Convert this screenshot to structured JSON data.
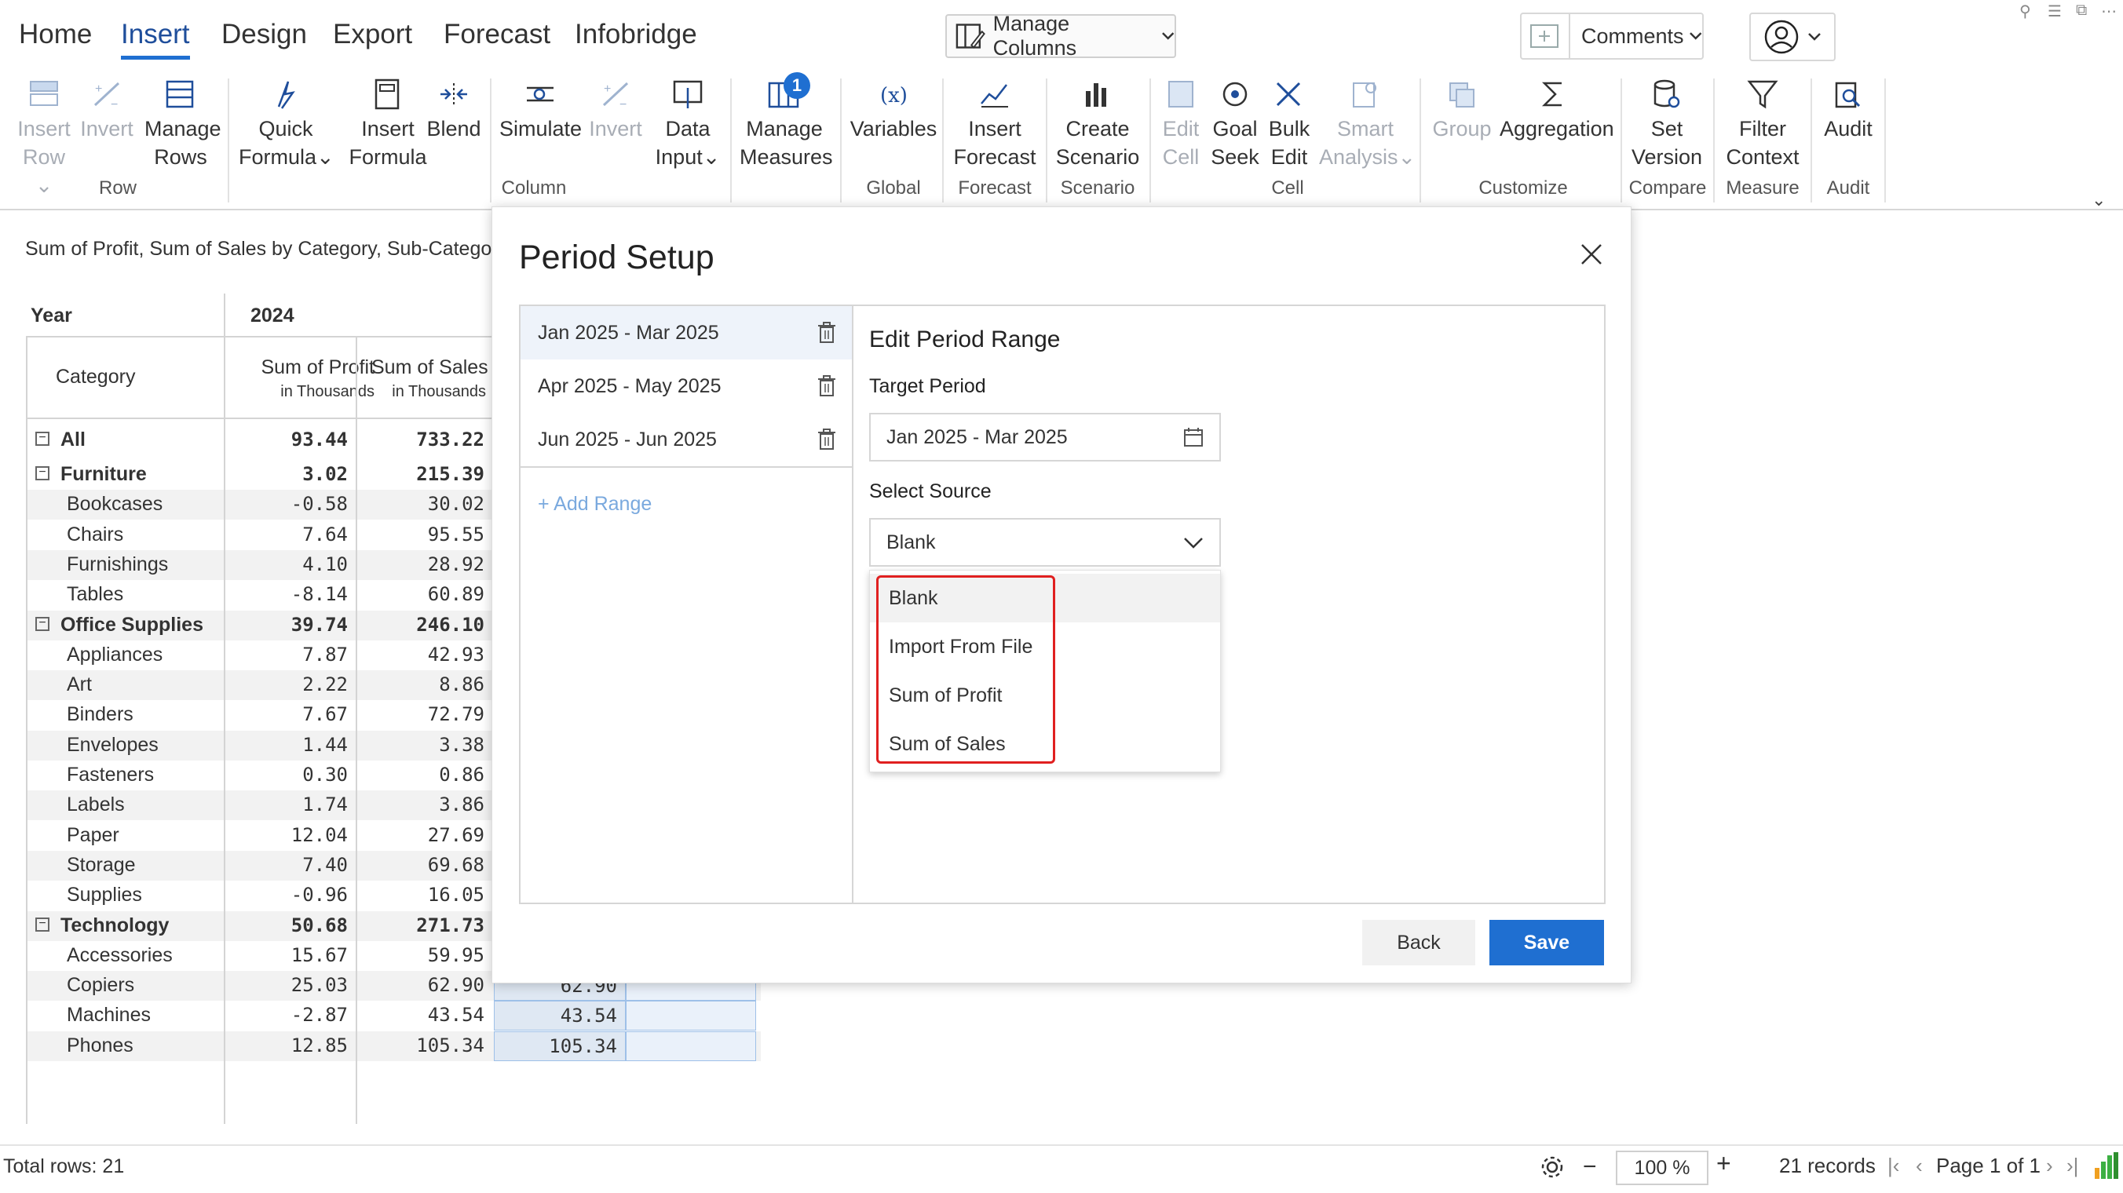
{
  "menu": {
    "tabs": [
      "Home",
      "Insert",
      "Design",
      "Export",
      "Forecast",
      "Infobridge"
    ],
    "active_tab": "Insert",
    "manage_columns": "Manage Columns",
    "comments": "Comments"
  },
  "ribbon": {
    "insert_row": [
      "Insert",
      "Row"
    ],
    "invert_row": "Invert",
    "manage_rows": [
      "Manage",
      "Rows"
    ],
    "group_row": "Row",
    "quick_formula": [
      "Quick",
      "Formula"
    ],
    "insert_formula": [
      "Insert",
      "Formula"
    ],
    "blend": "Blend",
    "simulate": "Simulate",
    "invert_col": "Invert",
    "data_input": [
      "Data",
      "Input"
    ],
    "group_column": "Column",
    "manage_measures": [
      "Manage",
      "Measures"
    ],
    "measures_badge": "1",
    "variables": "Variables",
    "group_global": "Global",
    "insert_forecast": [
      "Insert",
      "Forecast"
    ],
    "group_forecast": "Forecast",
    "create_scenario": [
      "Create",
      "Scenario"
    ],
    "group_scenario": "Scenario",
    "edit_cell": [
      "Edit",
      "Cell"
    ],
    "goal_seek": [
      "Goal",
      "Seek"
    ],
    "bulk_edit": [
      "Bulk",
      "Edit"
    ],
    "smart_analysis": [
      "Smart",
      "Analysis"
    ],
    "group_cell": "Cell",
    "group": "Group",
    "aggregation": "Aggregation",
    "group_customize": "Customize",
    "set_version": [
      "Set",
      "Version"
    ],
    "group_compare": "Compare",
    "filter_context": [
      "Filter",
      "Context"
    ],
    "group_measure": "Measure",
    "audit": "Audit",
    "group_audit": "Audit"
  },
  "report": {
    "title": "Sum of Profit, Sum of Sales by Category, Sub-Category",
    "year_label": "Year",
    "year_value": "2024",
    "category_label": "Category",
    "col_profit": "Sum of Profit",
    "col_profit_sub": "in Thousands",
    "col_sales": "Sum of Sales",
    "col_sales_sub": "in Thousands",
    "rows": [
      {
        "label": "All",
        "level": 0,
        "profit": "93.44",
        "sales": "733.22"
      },
      {
        "label": "Furniture",
        "level": 0,
        "profit": "3.02",
        "sales": "215.39"
      },
      {
        "label": "Bookcases",
        "level": 1,
        "profit": "-0.58",
        "sales": "30.02"
      },
      {
        "label": "Chairs",
        "level": 1,
        "profit": "7.64",
        "sales": "95.55"
      },
      {
        "label": "Furnishings",
        "level": 1,
        "profit": "4.10",
        "sales": "28.92"
      },
      {
        "label": "Tables",
        "level": 1,
        "profit": "-8.14",
        "sales": "60.89"
      },
      {
        "label": "Office Supplies",
        "level": 0,
        "profit": "39.74",
        "sales": "246.10"
      },
      {
        "label": "Appliances",
        "level": 1,
        "profit": "7.87",
        "sales": "42.93"
      },
      {
        "label": "Art",
        "level": 1,
        "profit": "2.22",
        "sales": "8.86"
      },
      {
        "label": "Binders",
        "level": 1,
        "profit": "7.67",
        "sales": "72.79"
      },
      {
        "label": "Envelopes",
        "level": 1,
        "profit": "1.44",
        "sales": "3.38"
      },
      {
        "label": "Fasteners",
        "level": 1,
        "profit": "0.30",
        "sales": "0.86"
      },
      {
        "label": "Labels",
        "level": 1,
        "profit": "1.74",
        "sales": "3.86"
      },
      {
        "label": "Paper",
        "level": 1,
        "profit": "12.04",
        "sales": "27.69"
      },
      {
        "label": "Storage",
        "level": 1,
        "profit": "7.40",
        "sales": "69.68"
      },
      {
        "label": "Supplies",
        "level": 1,
        "profit": "-0.96",
        "sales": "16.05"
      },
      {
        "label": "Technology",
        "level": 0,
        "profit": "50.68",
        "sales": "271.73"
      },
      {
        "label": "Accessories",
        "level": 1,
        "profit": "15.67",
        "sales": "59.95"
      },
      {
        "label": "Copiers",
        "level": 1,
        "profit": "25.03",
        "sales": "62.90",
        "extra": "62.90"
      },
      {
        "label": "Machines",
        "level": 1,
        "profit": "-2.87",
        "sales": "43.54",
        "extra": "43.54"
      },
      {
        "label": "Phones",
        "level": 1,
        "profit": "12.85",
        "sales": "105.34",
        "extra": "105.34"
      }
    ]
  },
  "modal": {
    "title": "Period Setup",
    "ranges": [
      "Jan 2025 - Mar 2025",
      "Apr 2025 - May 2025",
      "Jun 2025 - Jun 2025"
    ],
    "add_range": "+ Add Range",
    "edit_heading": "Edit Period Range",
    "target_period_label": "Target Period",
    "target_period_value": "Jan 2025 - Mar 2025",
    "select_source_label": "Select Source",
    "select_source_value": "Blank",
    "source_options": [
      "Blank",
      "Import From File",
      "Sum of Profit",
      "Sum of Sales"
    ],
    "back": "Back",
    "save": "Save"
  },
  "footer": {
    "total_rows": "Total rows: 21",
    "zoom": "100 %",
    "records": "21 records",
    "page": "Page 1 of 1"
  },
  "colors": {
    "accent": "#1f6fd1",
    "highlight": "#e02020",
    "selected_range_bg": "#eef3fa"
  }
}
